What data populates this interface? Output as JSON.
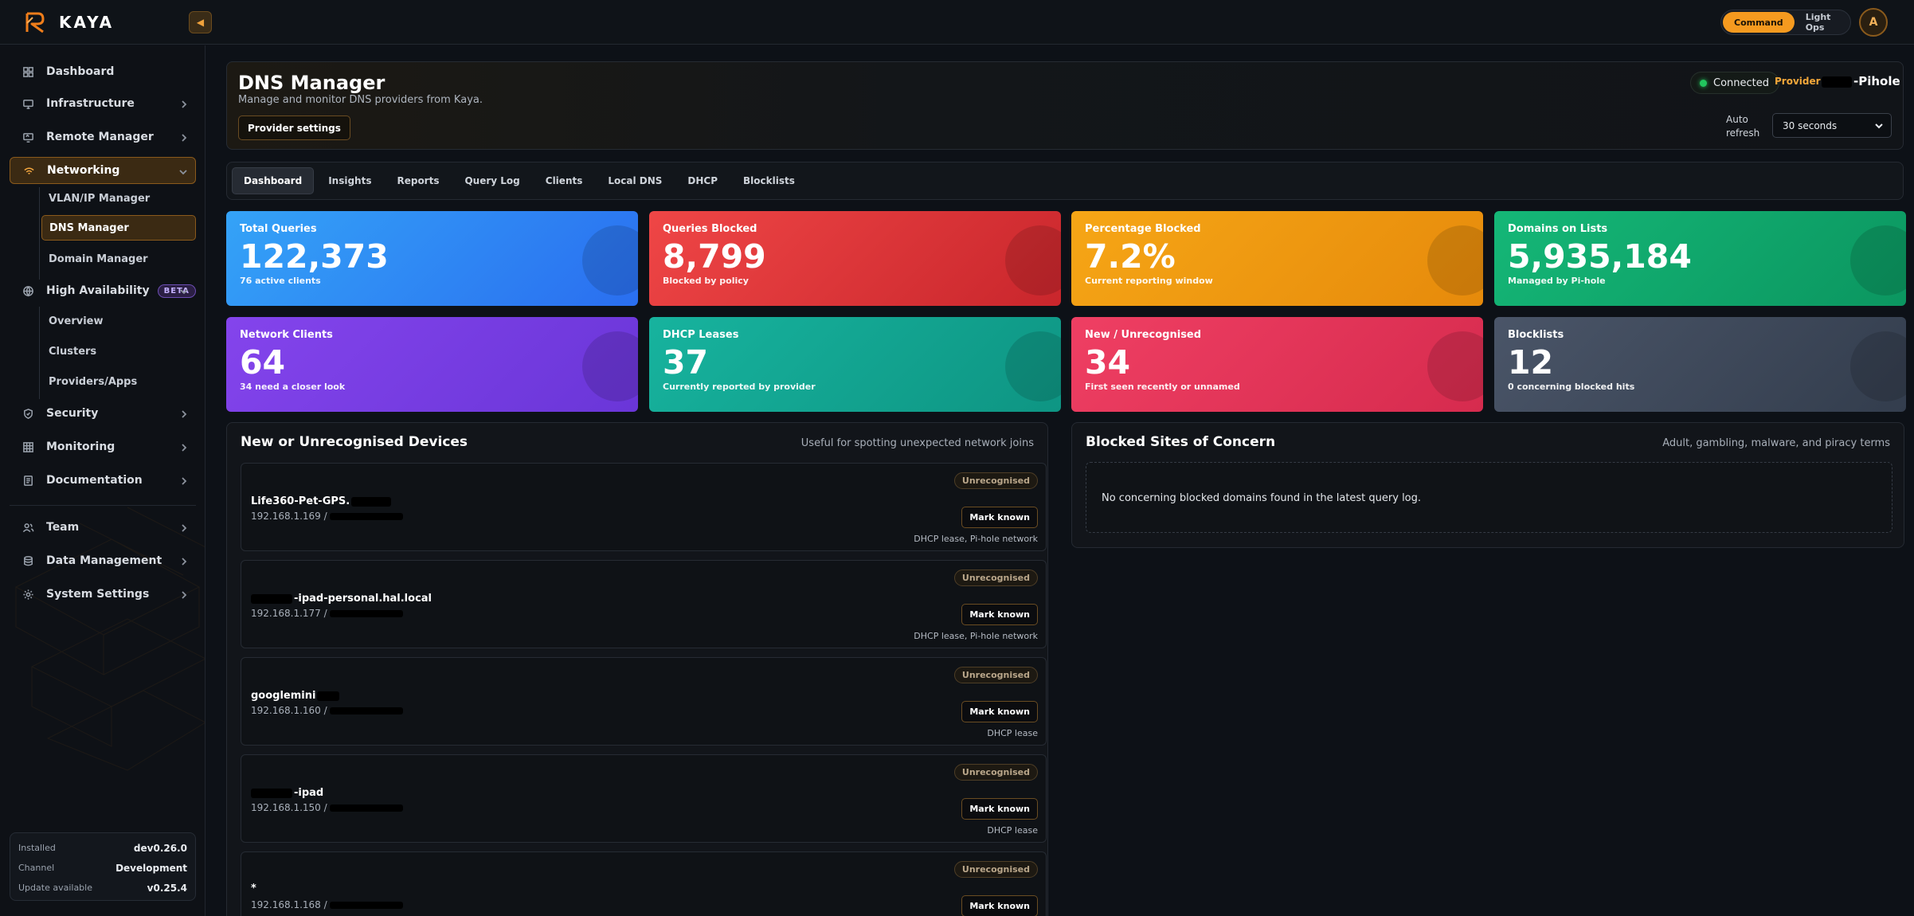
{
  "app": {
    "name": "KAYA"
  },
  "topbar": {
    "modes": [
      {
        "label": "Command",
        "active": true
      },
      {
        "label": "Light Ops",
        "active": false
      }
    ],
    "avatar_initial": "A"
  },
  "sidebar": {
    "items": [
      {
        "label": "Dashboard",
        "icon": "grid-icon"
      },
      {
        "label": "Infrastructure",
        "icon": "monitor-icon"
      },
      {
        "label": "Remote Manager",
        "icon": "remote-desktop-icon"
      },
      {
        "label": "Networking",
        "icon": "wifi-icon",
        "active": true
      },
      {
        "label": "High Availability",
        "icon": "globe-icon",
        "badge": "BETA"
      },
      {
        "label": "Security",
        "icon": "shield-icon"
      },
      {
        "label": "Monitoring",
        "icon": "table-icon"
      },
      {
        "label": "Documentation",
        "icon": "document-icon"
      },
      {
        "label": "Team",
        "icon": "users-icon"
      },
      {
        "label": "Data Management",
        "icon": "database-icon"
      },
      {
        "label": "System Settings",
        "icon": "gear-icon"
      }
    ],
    "networking_sub": [
      "VLAN/IP Manager",
      "DNS Manager",
      "Domain Manager"
    ],
    "ha_sub": [
      "Overview",
      "Clusters",
      "Providers/Apps"
    ],
    "version": {
      "installed_label": "Installed",
      "installed": "dev0.26.0",
      "channel_label": "Channel",
      "channel": "Development",
      "update_label": "Update available",
      "update": "v0.25.4"
    }
  },
  "header": {
    "title": "DNS Manager",
    "subtitle": "Manage and monitor DNS providers from Kaya.",
    "provider_settings": "Provider settings",
    "status": "Connected",
    "provider_label": "Provider",
    "provider_name": "-Pihole",
    "auto_refresh_label": "Auto refresh",
    "auto_refresh_value": "30 seconds"
  },
  "tabs": [
    "Dashboard",
    "Insights",
    "Reports",
    "Query Log",
    "Clients",
    "Local DNS",
    "DHCP",
    "Blocklists"
  ],
  "stats": [
    {
      "title": "Total Queries",
      "value": "122,373",
      "sub": "76 active clients",
      "color": "#2f8cf5"
    },
    {
      "title": "Queries Blocked",
      "value": "8,799",
      "sub": "Blocked by policy",
      "color": "#e5383b"
    },
    {
      "title": "Percentage Blocked",
      "value": "7.2%",
      "sub": "Current reporting window",
      "color": "#f29a0f"
    },
    {
      "title": "Domains on Lists",
      "value": "5,935,184",
      "sub": "Managed by Pi-hole",
      "color": "#10a86b"
    },
    {
      "title": "Network Clients",
      "value": "64",
      "sub": "34 need a closer look",
      "color": "#7b3fe6"
    },
    {
      "title": "DHCP Leases",
      "value": "37",
      "sub": "Currently reported by provider",
      "color": "#14a895"
    },
    {
      "title": "New / Unrecognised",
      "value": "34",
      "sub": "First seen recently or unnamed",
      "color": "#e8365c"
    },
    {
      "title": "Blocklists",
      "value": "12",
      "sub": "0 concerning blocked hits",
      "color": "#3d4859"
    }
  ],
  "devices_panel": {
    "title": "New or Unrecognised Devices",
    "hint": "Useful for spotting unexpected network joins",
    "badge": "Unrecognised",
    "mark_label": "Mark known",
    "devices": [
      {
        "name": "Life360-Pet-GPS.",
        "ip": "192.168.1.169 / ",
        "source": "DHCP lease, Pi-hole network"
      },
      {
        "name": "-ipad-personal.hal.local",
        "ip": "192.168.1.177 / ",
        "source": "DHCP lease, Pi-hole network"
      },
      {
        "name": "googlemini",
        "ip": "192.168.1.160 / ",
        "source": "DHCP lease"
      },
      {
        "name": "-ipad",
        "ip": "192.168.1.150 / ",
        "source": "DHCP lease"
      },
      {
        "name": "*",
        "ip": "192.168.1.168 / ",
        "source": ""
      }
    ]
  },
  "blocked_panel": {
    "title": "Blocked Sites of Concern",
    "hint": "Adult, gambling, malware, and piracy terms",
    "empty": "No concerning blocked domains found in the latest query log."
  }
}
